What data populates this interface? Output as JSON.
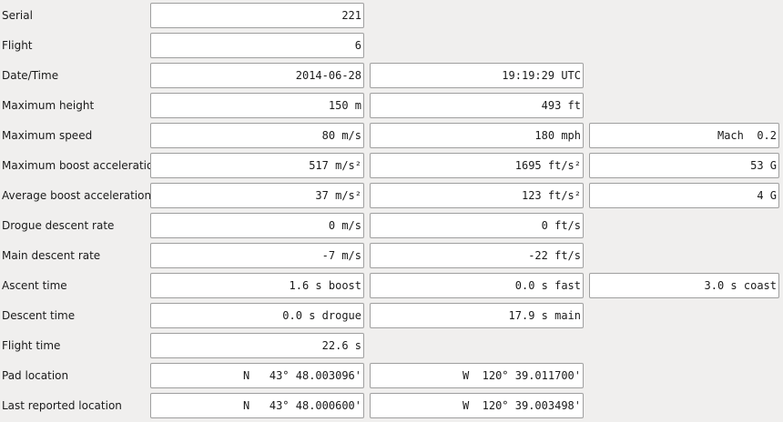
{
  "rows": [
    {
      "label": "Serial",
      "values": [
        "221"
      ]
    },
    {
      "label": "Flight",
      "values": [
        "6"
      ]
    },
    {
      "label": "Date/Time",
      "values": [
        "2014-06-28",
        "19:19:29 UTC"
      ]
    },
    {
      "label": "Maximum height",
      "values": [
        "150 m",
        "493 ft"
      ]
    },
    {
      "label": "Maximum speed",
      "values": [
        "80 m/s",
        "180 mph",
        "Mach  0.2"
      ]
    },
    {
      "label": "Maximum boost acceleration",
      "values": [
        "517 m/s²",
        "1695 ft/s²",
        "53 G"
      ]
    },
    {
      "label": "Average boost acceleration",
      "values": [
        "37 m/s²",
        "123 ft/s²",
        "4 G"
      ]
    },
    {
      "label": "Drogue descent rate",
      "values": [
        "0 m/s",
        "0 ft/s"
      ]
    },
    {
      "label": "Main descent rate",
      "values": [
        "-7 m/s",
        "-22 ft/s"
      ]
    },
    {
      "label": "Ascent time",
      "values": [
        "1.6 s boost",
        "0.0 s fast",
        "3.0 s coast"
      ]
    },
    {
      "label": "Descent time",
      "values": [
        "0.0 s drogue",
        "17.9 s main"
      ]
    },
    {
      "label": "Flight time",
      "values": [
        "22.6 s"
      ]
    },
    {
      "label": "Pad location",
      "values": [
        "N   43° 48.003096'",
        "W  120° 39.011700'"
      ]
    },
    {
      "label": "Last reported location",
      "values": [
        "N   43° 48.000600'",
        "W  120° 39.003498'"
      ]
    }
  ]
}
